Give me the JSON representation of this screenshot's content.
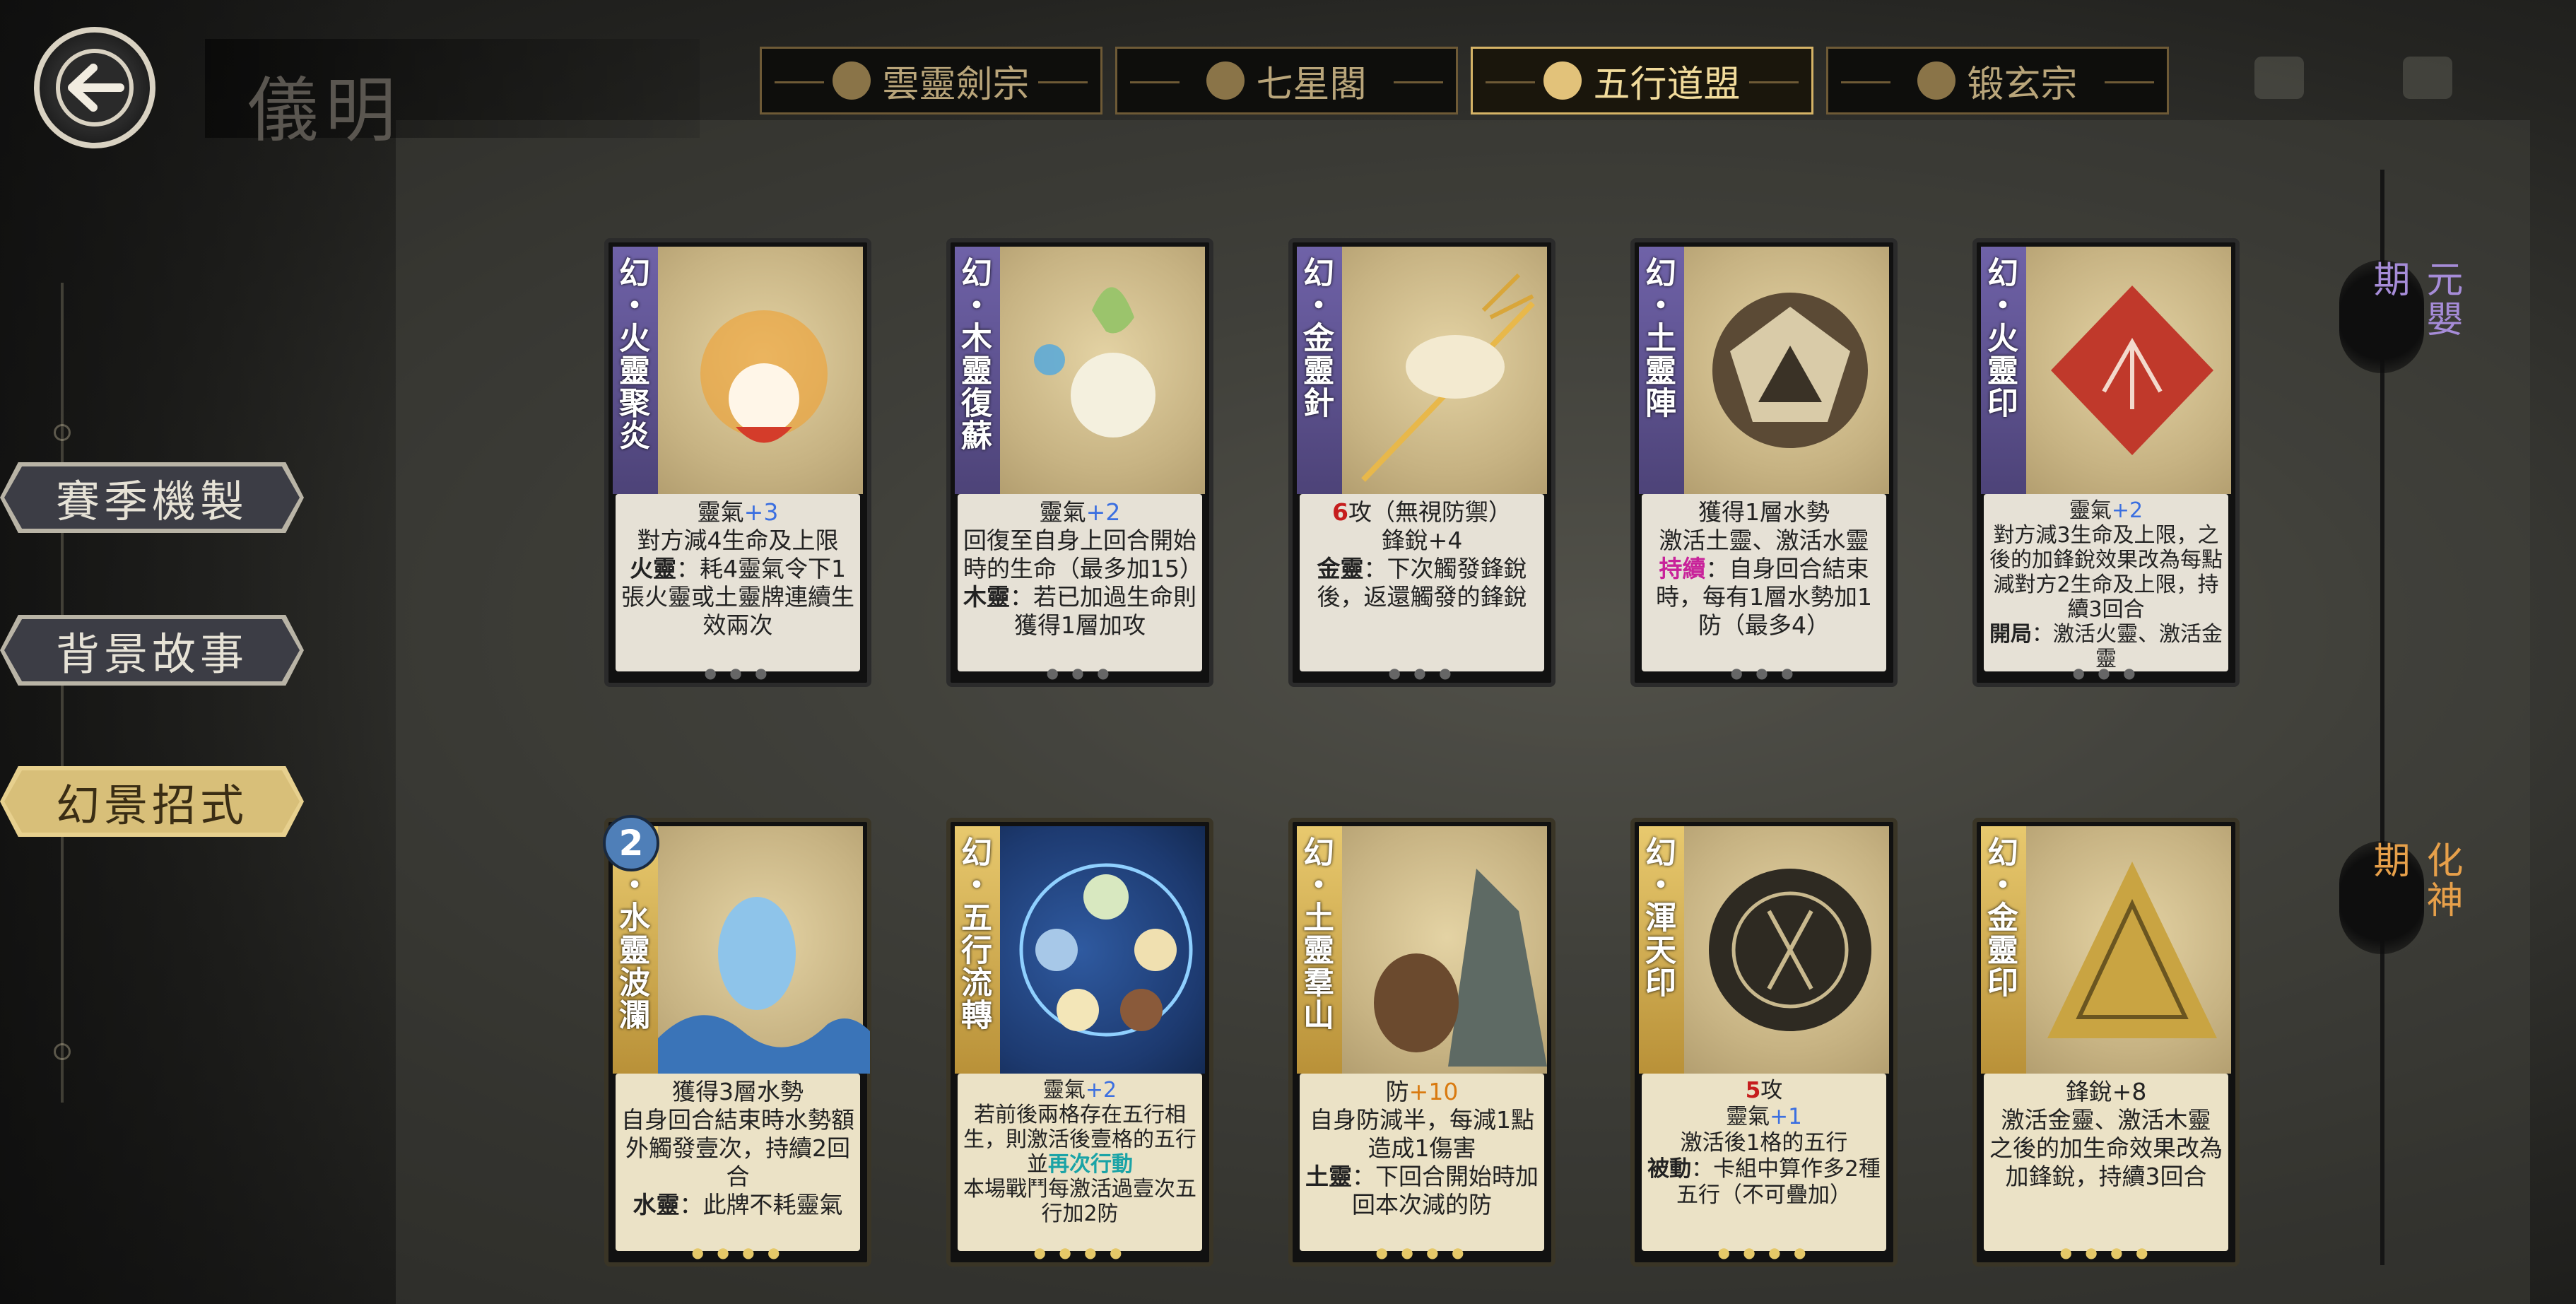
{
  "header": {
    "title_watermark": "儀明"
  },
  "tabs": [
    {
      "label": "雲靈劍宗",
      "icon": "cloud-sword-icon",
      "active": false
    },
    {
      "label": "七星閣",
      "icon": "pagoda-icon",
      "active": false
    },
    {
      "label": "五行道盟",
      "icon": "five-elements-icon",
      "active": true
    },
    {
      "label": "锻玄宗",
      "icon": "flame-icon",
      "active": false
    }
  ],
  "sidebar": {
    "items": [
      {
        "label": "賽季機製",
        "active": false
      },
      {
        "label": "背景故事",
        "active": false
      },
      {
        "label": "幻景招式",
        "active": true
      }
    ]
  },
  "realms": [
    "元嬰期",
    "化神期"
  ],
  "cards": [
    {
      "name": "幻・火靈聚炎",
      "tier": "purple",
      "desc": {
        "l1a": "靈氣",
        "l1b": "+3",
        "l2": "對方減4生命及上限",
        "l3a": "火靈",
        "l3b": "：耗4靈氣令下1張火靈或土靈牌連續生效兩次"
      }
    },
    {
      "name": "幻・木靈復蘇",
      "tier": "purple",
      "desc": {
        "l1a": "靈氣",
        "l1b": "+2",
        "l2": "回復至自身上回合開始時的生命（最多加15）",
        "l3a": "木靈",
        "l3b": "：若已加過生命則獲得1層加攻"
      }
    },
    {
      "name": "幻・金靈針",
      "tier": "purple",
      "desc": {
        "l1a": "6",
        "l1b": "攻（無視防禦）",
        "l2": "鋒銳+4",
        "l3a": "金靈",
        "l3b": "：下次觸發鋒銳後，返還觸發的鋒銳"
      }
    },
    {
      "name": "幻・土靈陣",
      "tier": "purple",
      "desc": {
        "l1a": "獲得1層水勢",
        "l2": "激活土靈、激活水靈",
        "l3a": "持續",
        "l3b": "：自身回合結束時，每有1層水勢加1防（最多4）"
      }
    },
    {
      "name": "幻・火靈印",
      "tier": "purple",
      "desc": {
        "l1a": "靈氣",
        "l1b": "+2",
        "l2": "對方減3生命及上限，之後的加鋒銳效果改為每點減對方2生命及上限，持續3回合",
        "l3a": "開局",
        "l3b": "：激活火靈、激活金靈"
      }
    },
    {
      "name": "幻・水靈波瀾",
      "tier": "gold",
      "badge": "2",
      "desc": {
        "l1a": "獲得3層水勢",
        "l2": "自身回合結束時水勢額外觸發壹次，持續2回合",
        "l3a": "水靈",
        "l3b": "：此牌不耗靈氣"
      }
    },
    {
      "name": "幻・五行流轉",
      "tier": "gold",
      "desc": {
        "l1a": "靈氣",
        "l1b": "+2",
        "l2": "若前後兩格存在五行相生，則激活後壹格的五行並",
        "l2c": "再次行動",
        "l3a": "",
        "l3b": "本場戰鬥每激活過壹次五行加2防"
      }
    },
    {
      "name": "幻・土靈羣山",
      "tier": "gold",
      "desc": {
        "l1a": "防",
        "l1b": "+10",
        "l2": "自身防減半，每減1點造成1傷害",
        "l3a": "土靈",
        "l3b": "：下回合開始時加回本次減的防"
      }
    },
    {
      "name": "幻・渾天印",
      "tier": "gold",
      "desc": {
        "l1a": "5",
        "l1b": "攻",
        "l2a": "靈氣",
        "l2b": "+1",
        "l2": "激活後1格的五行",
        "l3a": "被動",
        "l3b": "：卡組中算作多2種五行（不可疊加）"
      }
    },
    {
      "name": "幻・金靈印",
      "tier": "gold",
      "desc": {
        "l1a": "鋒銳+8",
        "l2": "激活金靈、激活木靈",
        "l3a": "",
        "l3b": "之後的加生命效果改為加鋒銳，持續3回合"
      }
    }
  ],
  "colors": {
    "accent_gold": "#d5b366",
    "purple_tier": "#6f62a8",
    "gold_tier": "#e8c96e",
    "blue_num": "#3b6fe0"
  }
}
